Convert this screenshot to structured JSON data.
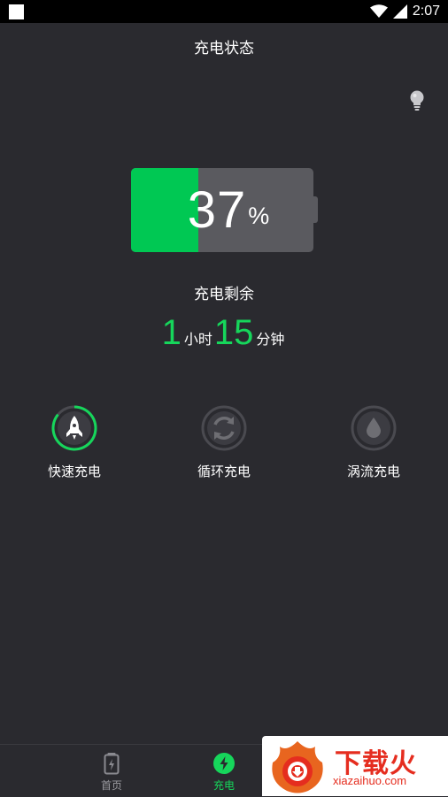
{
  "status_bar": {
    "time": "2:07"
  },
  "header": {
    "title": "充电状态"
  },
  "battery": {
    "percent_value": "37",
    "percent_sign": "%",
    "level": 0.37,
    "fill_color": "#00c853"
  },
  "remaining": {
    "label": "充电剩余",
    "hours": "1",
    "hours_unit": "小时",
    "minutes": "15",
    "minutes_unit": "分钟"
  },
  "modes": [
    {
      "label": "快速充电",
      "icon": "rocket-icon",
      "active": true
    },
    {
      "label": "循环充电",
      "icon": "cycle-icon",
      "active": false
    },
    {
      "label": "涡流充电",
      "icon": "drop-icon",
      "active": false
    }
  ],
  "tabs": [
    {
      "label": "首页",
      "icon": "battery-icon",
      "active": false
    },
    {
      "label": "充电",
      "icon": "lightning-icon",
      "active": true
    }
  ],
  "watermark": {
    "title": "下载火",
    "subtitle": "xiazaihuo.com"
  },
  "colors": {
    "accent": "#16d65b",
    "background": "#2a2a2f",
    "inactive": "#6e6e73"
  }
}
